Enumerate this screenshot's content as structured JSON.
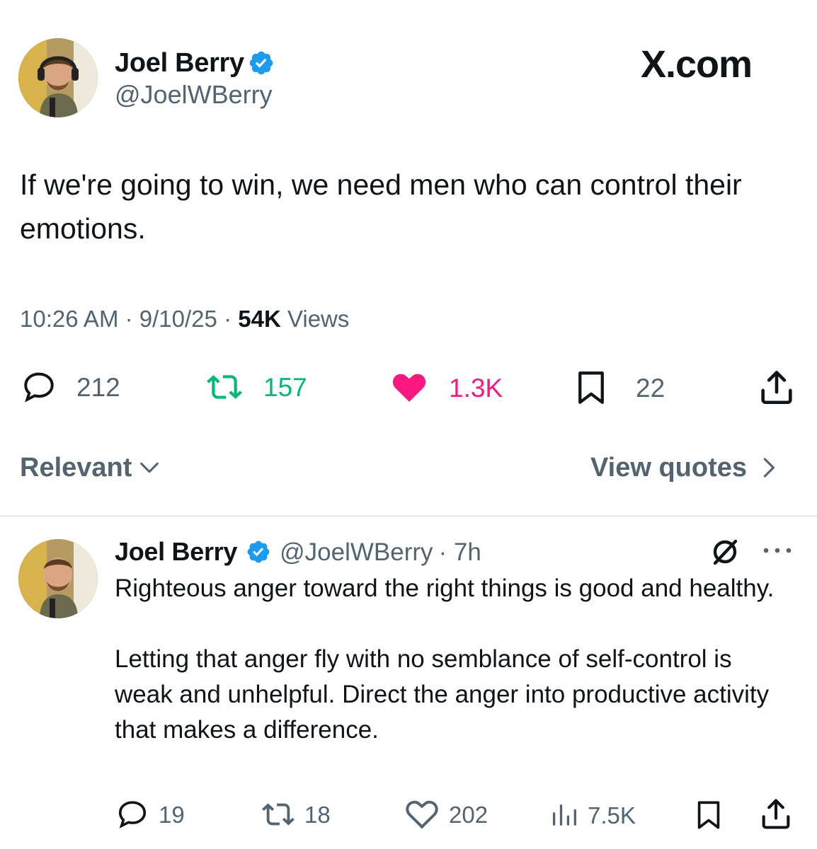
{
  "brand": {
    "label": "X.com"
  },
  "main_tweet": {
    "author": {
      "name": "Joel Berry",
      "handle": "@JoelWBerry"
    },
    "text": "If we're going to win, we need men who can control their emotions.",
    "time": "10:26 AM",
    "date": "9/10/25",
    "views_count": "54K",
    "views_label": "Views",
    "separator": "·",
    "actions": {
      "replies": "212",
      "reposts": "157",
      "likes": "1.3K",
      "bookmarks": "22"
    },
    "colors": {
      "repost": "#00ba7c",
      "like": "#f91880",
      "muted": "#536471",
      "verified": "#1d9bf0"
    }
  },
  "sort": {
    "label": "Relevant"
  },
  "quotes_link": {
    "label": "View quotes"
  },
  "reply": {
    "author": {
      "name": "Joel Berry",
      "handle": "@JoelWBerry",
      "age": "· 7h"
    },
    "paragraphs": [
      "Righteous anger toward the right things is good and healthy.",
      "Letting that anger fly with no semblance of self-control is weak and unhelpful. Direct the anger into productive activity that makes a difference."
    ],
    "actions": {
      "replies": "19",
      "reposts": "18",
      "likes": "202",
      "views": "7.5K"
    }
  },
  "icons": [
    "verified-badge-icon",
    "reply-icon",
    "repost-icon",
    "like-icon",
    "bookmark-icon",
    "share-icon",
    "chevron-down-icon",
    "chevron-right-icon",
    "grok-icon",
    "more-icon",
    "views-icon"
  ]
}
